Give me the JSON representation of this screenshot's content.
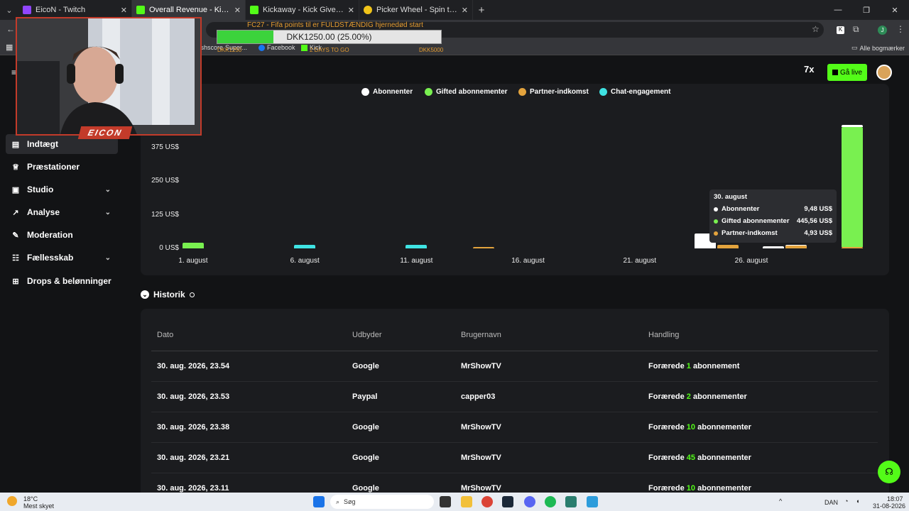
{
  "browser": {
    "tabs": [
      {
        "title": "EicoN - Twitch",
        "color": "#9146ff"
      },
      {
        "title": "Overall Revenue - Kick Dashboar",
        "color": "#53fc18"
      },
      {
        "title": "Kickaway - Kick Giveaway Tool",
        "color": "#53fc18"
      },
      {
        "title": "Picker Wheel - Spin the Wheel",
        "color": "#f0c419"
      }
    ],
    "bookmarks": {
      "item1": "Flashscore ",
      "item2": "Super...",
      "item3": "Facebook",
      "item4": "Kick",
      "all": "Alle bogmærker"
    }
  },
  "stream_overlay": {
    "goal_title": "FC27 - Fifa points til er FULDSTÆNDIG hjernedød start",
    "goal_progress_text": "DKK1250.00 (25.00%)",
    "goal_progress_fraction": 0.25,
    "goal_left": "DKK1250",
    "goal_days": "2 DAYS TO GO",
    "goal_right": "DKK5000",
    "streamer_name": "EICON"
  },
  "header": {
    "go_live": "Gå live"
  },
  "sidebar": {
    "items": [
      {
        "label": "Indtægt",
        "icon": "revenue-icon"
      },
      {
        "label": "Præstationer",
        "icon": "trophy-icon"
      },
      {
        "label": "Studio",
        "icon": "studio-icon"
      },
      {
        "label": "Analyse",
        "icon": "analytics-icon"
      },
      {
        "label": "Moderation",
        "icon": "wrench-icon"
      },
      {
        "label": "Fællesskab",
        "icon": "community-icon"
      },
      {
        "label": "Drops & belønninger",
        "icon": "gift-icon"
      }
    ]
  },
  "chart_data": {
    "type": "bar",
    "legend": [
      {
        "name": "Abonnenter",
        "color": "#ffffff"
      },
      {
        "name": "Gifted abonnementer",
        "color": "#79f050"
      },
      {
        "name": "Partner-indkomst",
        "color": "#e3a33d"
      },
      {
        "name": "Chat-engagement",
        "color": "#3fe3e3"
      }
    ],
    "ytick_labels": [
      "0 US$",
      "125 US$",
      "250 US$",
      "375 US$"
    ],
    "xtick_labels": [
      "1. august",
      "6. august",
      "11. august",
      "16. august",
      "21. august",
      "26. august"
    ],
    "ylim": [
      0,
      500
    ],
    "bars": [
      {
        "date": "1. august",
        "series": "Gifted abonnementer",
        "value": 22
      },
      {
        "date": "6. august",
        "series": "Chat-engagement",
        "value": 12
      },
      {
        "date": "11. august",
        "series": "Chat-engagement",
        "value": 14
      },
      {
        "date": "14. august",
        "series": "Partner-indkomst",
        "value": 3
      },
      {
        "date": "24. august",
        "series": "Abonnenter",
        "value": 56
      },
      {
        "date": "24. august",
        "series": "Partner-indkomst",
        "value": 12
      },
      {
        "date": "27. august",
        "series": "Abonnenter",
        "value": 9
      },
      {
        "date": "28. august",
        "series": "Abonnenter",
        "value": 14
      },
      {
        "date": "28. august",
        "series": "Partner-indkomst",
        "value": 10
      },
      {
        "date": "30. august",
        "series": "Partner-indkomst",
        "value": 4.93
      },
      {
        "date": "30. august",
        "series": "Gifted abonnementer",
        "value": 445.56
      },
      {
        "date": "30. august",
        "series": "Abonnenter",
        "value": 9.48
      }
    ],
    "tooltip": {
      "title": "30. august",
      "rows": [
        {
          "name": "Abonnenter",
          "value": "9,48 US$",
          "color": "#ffffff"
        },
        {
          "name": "Gifted abonnementer",
          "value": "445,56 US$",
          "color": "#79f050"
        },
        {
          "name": "Partner-indkomst",
          "value": "4,93 US$",
          "color": "#e3a33d"
        }
      ]
    }
  },
  "history": {
    "title": "Historik",
    "columns": [
      "Dato",
      "Udbyder",
      "Brugernavn",
      "Handling"
    ],
    "rows": [
      {
        "date": "30. aug. 2026, 23.54",
        "provider": "Google",
        "user": "MrShowTV",
        "pre": "Forærede ",
        "num": "1",
        "post": " abonnement"
      },
      {
        "date": "30. aug. 2026, 23.53",
        "provider": "Paypal",
        "user": "capper03",
        "pre": "Forærede ",
        "num": "2",
        "post": " abonnementer"
      },
      {
        "date": "30. aug. 2026, 23.38",
        "provider": "Google",
        "user": "MrShowTV",
        "pre": "Forærede ",
        "num": "10",
        "post": " abonnementer"
      },
      {
        "date": "30. aug. 2026, 23.21",
        "provider": "Google",
        "user": "MrShowTV",
        "pre": "Forærede ",
        "num": "45",
        "post": " abonnementer"
      },
      {
        "date": "30. aug. 2026, 23.11",
        "provider": "Google",
        "user": "MrShowTV",
        "pre": "Forærede ",
        "num": "10",
        "post": " abonnementer"
      }
    ]
  },
  "taskbar": {
    "weather_temp": "18°C",
    "weather_desc": "Mest skyet",
    "search_placeholder": "Søg",
    "lang": "DAN",
    "time": "18:07",
    "date": "31-08-2026"
  }
}
